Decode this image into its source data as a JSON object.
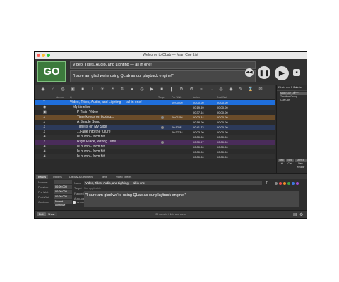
{
  "window": {
    "title": "Welcome to QLab — Main Cue List"
  },
  "top": {
    "go_label": "GO",
    "cue_name": "Video, Titles, Audio, and Lighting — all in one!",
    "cue_notes": "\"I sure am glad we're using QLab as our playback engine!\""
  },
  "columns": {
    "number": "Number",
    "q": "Q",
    "target": "Target",
    "prewait": "Pre Wait",
    "action": "Action",
    "postwait": "Post Wait"
  },
  "rows": [
    {
      "name": "Video, Titles, Audio, and Lighting — all in one!",
      "prewait": "00:00.00",
      "action": "00:00.00",
      "postwait": "00:00.00"
    },
    {
      "name": "My timeline",
      "prewait": "",
      "action": "00:19.59",
      "postwait": "00:00.00"
    },
    {
      "name": "P Train Video",
      "prewait": "",
      "action": "00:37.64",
      "postwait": "00:00.00"
    },
    {
      "name": "Time keeps on ticking...",
      "prewait": "00:01.56",
      "action": "00:03.44",
      "postwait": "00:00.00"
    },
    {
      "name": "A Simple Song",
      "prewait": "",
      "action": "00:18.00",
      "postwait": "00:00.00"
    },
    {
      "name": "Time is on My Side",
      "prewait": "00:12.81",
      "action": "00:41.73",
      "postwait": "00:00.00"
    },
    {
      "name": "...Fade into the future",
      "prewait": "00:37.34",
      "action": "00:03.00",
      "postwait": "00:00.00"
    },
    {
      "name": "Is bump - form hit",
      "prewait": "",
      "action": "00:00.00",
      "postwait": "00:00.00"
    },
    {
      "name": "Right Place, Wrong Time",
      "prewait": "",
      "action": "00:30.97",
      "postwait": "00:00.00"
    },
    {
      "name": "Is bump - form hit",
      "prewait": "",
      "action": "00:00.00",
      "postwait": "00:00.00"
    },
    {
      "name": "Is bump - form hit",
      "prewait": "",
      "action": "00:00.00",
      "postwait": "00:00.00"
    },
    {
      "name": "Is bump - form hit",
      "prewait": "",
      "action": "00:00.00",
      "postwait": "00:00.00"
    }
  ],
  "sidebar": {
    "tab_lists": "2 Lists and 1 Cart",
    "tab_active": "0 Active Cues",
    "items": [
      "Main Cue List",
      "Timeline Group",
      "Cue Cart"
    ],
    "btn_new_list": "New List",
    "btn_new_cart": "New Cart",
    "btn_open_new": "Open in New Window"
  },
  "inspector": {
    "tabs": [
      "Basics",
      "Triggers",
      "Display & Geometry",
      "Text",
      "Video Effects"
    ],
    "labels": {
      "number": "Number",
      "duration": "Duration",
      "pre_wait": "Pre Wait",
      "post_wait": "Post Wait",
      "continue": "Continue",
      "name": "Name",
      "target": "Target",
      "flagged": "Flagged",
      "auto_load": "Auto-load"
    },
    "number_value": "",
    "duration_value": "00:00.000",
    "pre_wait_value": "00:00.000",
    "post_wait_value": "00:00.000",
    "continue_value": "Do not continue",
    "armed_label": "Armed",
    "name_value": "Video, Titles, Audio, and Lighting — all in one!",
    "target_value": "Not applicable",
    "notes_value": "\"I sure am glad we're using QLab as our playback engine!\""
  },
  "statusbar": {
    "edit_label": "Edit",
    "show_label": "Show",
    "count_text": "20 cues in 4 lists and carts"
  },
  "colors": {
    "row_selected": "#1f6fdc",
    "row_orange": "#6a4c2a",
    "row_blue": "#2c3a5a",
    "row_purple": "#4a2c5a",
    "go_green": "#3c7a3c"
  }
}
